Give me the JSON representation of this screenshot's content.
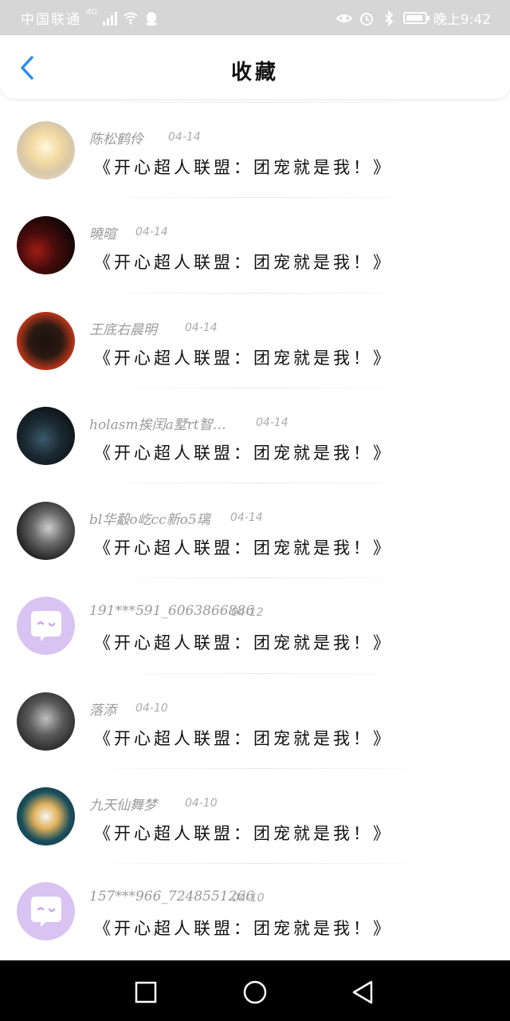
{
  "status_bar": {
    "carrier": "中国联通",
    "network": "4G",
    "time": "晚上9:42",
    "battery_level": 0.9
  },
  "header": {
    "title": "收藏",
    "back_icon": "chevron-left-icon",
    "accent_color": "#2a8ff0"
  },
  "favorites": [
    {
      "username": "陈松鹤伶",
      "date": "04-14",
      "content": "《开心超人联盟：团宠就是我！》"
    },
    {
      "username": "曉暄",
      "date": "04-14",
      "content": "《开心超人联盟：团宠就是我！》"
    },
    {
      "username": "王底右晨明",
      "date": "04-14",
      "content": "《开心超人联盟：团宠就是我！》"
    },
    {
      "username": "holasm挨闰a墅rt智…",
      "date": "04-14",
      "content": "《开心超人联盟：团宠就是我！》"
    },
    {
      "username": "bl华觳o屹cc新o5璃",
      "date": "04-14",
      "content": "《开心超人联盟：团宠就是我！》"
    },
    {
      "username": "191***591_6063866886",
      "date": "04-12",
      "content": "《开心超人联盟：团宠就是我！》"
    },
    {
      "username": "落添",
      "date": "04-10",
      "content": "《开心超人联盟：团宠就是我！》"
    },
    {
      "username": "九天仙舞梦",
      "date": "04-10",
      "content": "《开心超人联盟：团宠就是我！》"
    },
    {
      "username": "157***966_7248551266",
      "date": "04-10",
      "content": "《开心超人联盟：团宠就是我！》"
    }
  ],
  "nav_bar": {
    "recent_icon": "square-icon",
    "home_icon": "circle-icon",
    "back_icon": "triangle-back-icon"
  }
}
